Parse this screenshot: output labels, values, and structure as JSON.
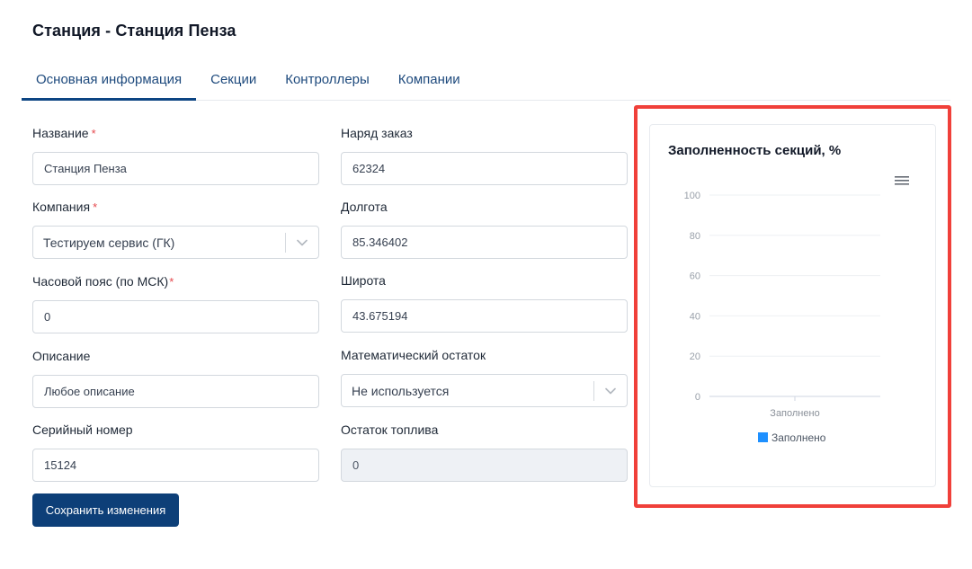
{
  "page": {
    "title": "Станция - Станция Пенза"
  },
  "tabs": [
    {
      "label": "Основная информация",
      "active": true
    },
    {
      "label": "Секции",
      "active": false
    },
    {
      "label": "Контроллеры",
      "active": false
    },
    {
      "label": "Компании",
      "active": false
    }
  ],
  "form": {
    "name": {
      "label": "Название",
      "value": "Станция Пенза",
      "required": "*"
    },
    "company": {
      "label": "Компания",
      "value": "Тестируем сервис (ГК)",
      "required": "*"
    },
    "timezone": {
      "label": "Часовой пояс (по МСК)",
      "value": "0",
      "required": "*"
    },
    "description": {
      "label": "Описание",
      "value": "Любое описание"
    },
    "serial": {
      "label": "Серийный номер",
      "value": "15124"
    },
    "work_order": {
      "label": "Наряд заказ",
      "value": "62324"
    },
    "longitude": {
      "label": "Долгота",
      "value": "85.346402"
    },
    "latitude": {
      "label": "Широта",
      "value": "43.675194"
    },
    "math_remainder": {
      "label": "Математический остаток",
      "value": "Не используется"
    },
    "fuel_remainder": {
      "label": "Остаток топлива",
      "value": "0"
    }
  },
  "actions": {
    "save_label": "Сохранить изменения"
  },
  "colors": {
    "accent": "#0d3f78",
    "tab_text": "#1e4a7d",
    "required": "#e5484d",
    "highlight": "#f0403a",
    "series": "#1e90ff"
  },
  "chart_data": {
    "type": "bar",
    "title": "Заполненность секций, %",
    "categories": [
      "Заполнено"
    ],
    "series": [
      {
        "name": "Заполнено",
        "values": [
          0
        ]
      }
    ],
    "ylim": [
      0,
      100
    ],
    "yticks": [
      0,
      20,
      40,
      60,
      80,
      100
    ],
    "grid": true,
    "legend": "bottom"
  }
}
